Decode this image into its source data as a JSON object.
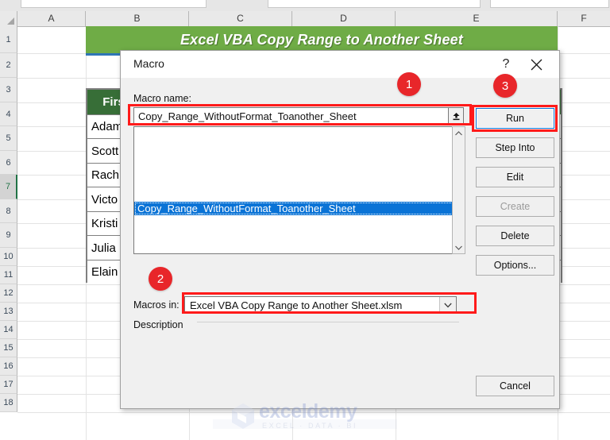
{
  "app": {
    "banner_title": "Excel VBA Copy Range to Another Sheet",
    "banner_color": "#6fac46"
  },
  "sheet": {
    "column_headers": [
      "A",
      "B",
      "C",
      "D",
      "E",
      "F"
    ],
    "row_headers": [
      "1",
      "2",
      "3",
      "4",
      "5",
      "6",
      "7",
      "8",
      "9",
      "10",
      "11",
      "12",
      "13",
      "14",
      "15",
      "16",
      "17",
      "18"
    ],
    "selected_row": "7",
    "table": {
      "header": "First Name",
      "header_visible": "Firs",
      "rows": [
        {
          "full": "Adam Smith",
          "visible": "Adam"
        },
        {
          "full": "Scott",
          "visible": "Scott"
        },
        {
          "full": "Rachel",
          "visible": "Rach"
        },
        {
          "full": "Victoria",
          "visible": "Victo"
        },
        {
          "full": "Kristine",
          "visible": "Kristi"
        },
        {
          "full": "Julia",
          "visible": "Julia"
        },
        {
          "full": "Elaine",
          "visible": "Elain"
        }
      ]
    }
  },
  "dialog": {
    "title": "Macro",
    "help_glyph": "?",
    "macro_name_label": "Macro name:",
    "macro_name_value": "Copy_Range_WithoutFormat_Toanother_Sheet",
    "list_items": [
      "Copy_Range_WithoutFormat_Toanother_Sheet"
    ],
    "selected_list_item": "Copy_Range_WithoutFormat_Toanother_Sheet",
    "macros_in_label": "Macros in:",
    "macros_in_value": "Excel VBA Copy Range to Another Sheet.xlsm",
    "description_label": "Description",
    "description_value": "",
    "buttons": {
      "run": "Run",
      "step_into": "Step Into",
      "edit": "Edit",
      "create": "Create",
      "delete": "Delete",
      "options": "Options...",
      "cancel": "Cancel"
    },
    "selection_color": "#0a73d6",
    "highlight_color": "#ff1a1a"
  },
  "annotations": {
    "badge_1": "1",
    "badge_2": "2",
    "badge_3": "3",
    "badge_color": "#e8262a"
  },
  "watermark": {
    "name": "exceldemy",
    "tagline": "EXCEL · DATA · BI"
  }
}
